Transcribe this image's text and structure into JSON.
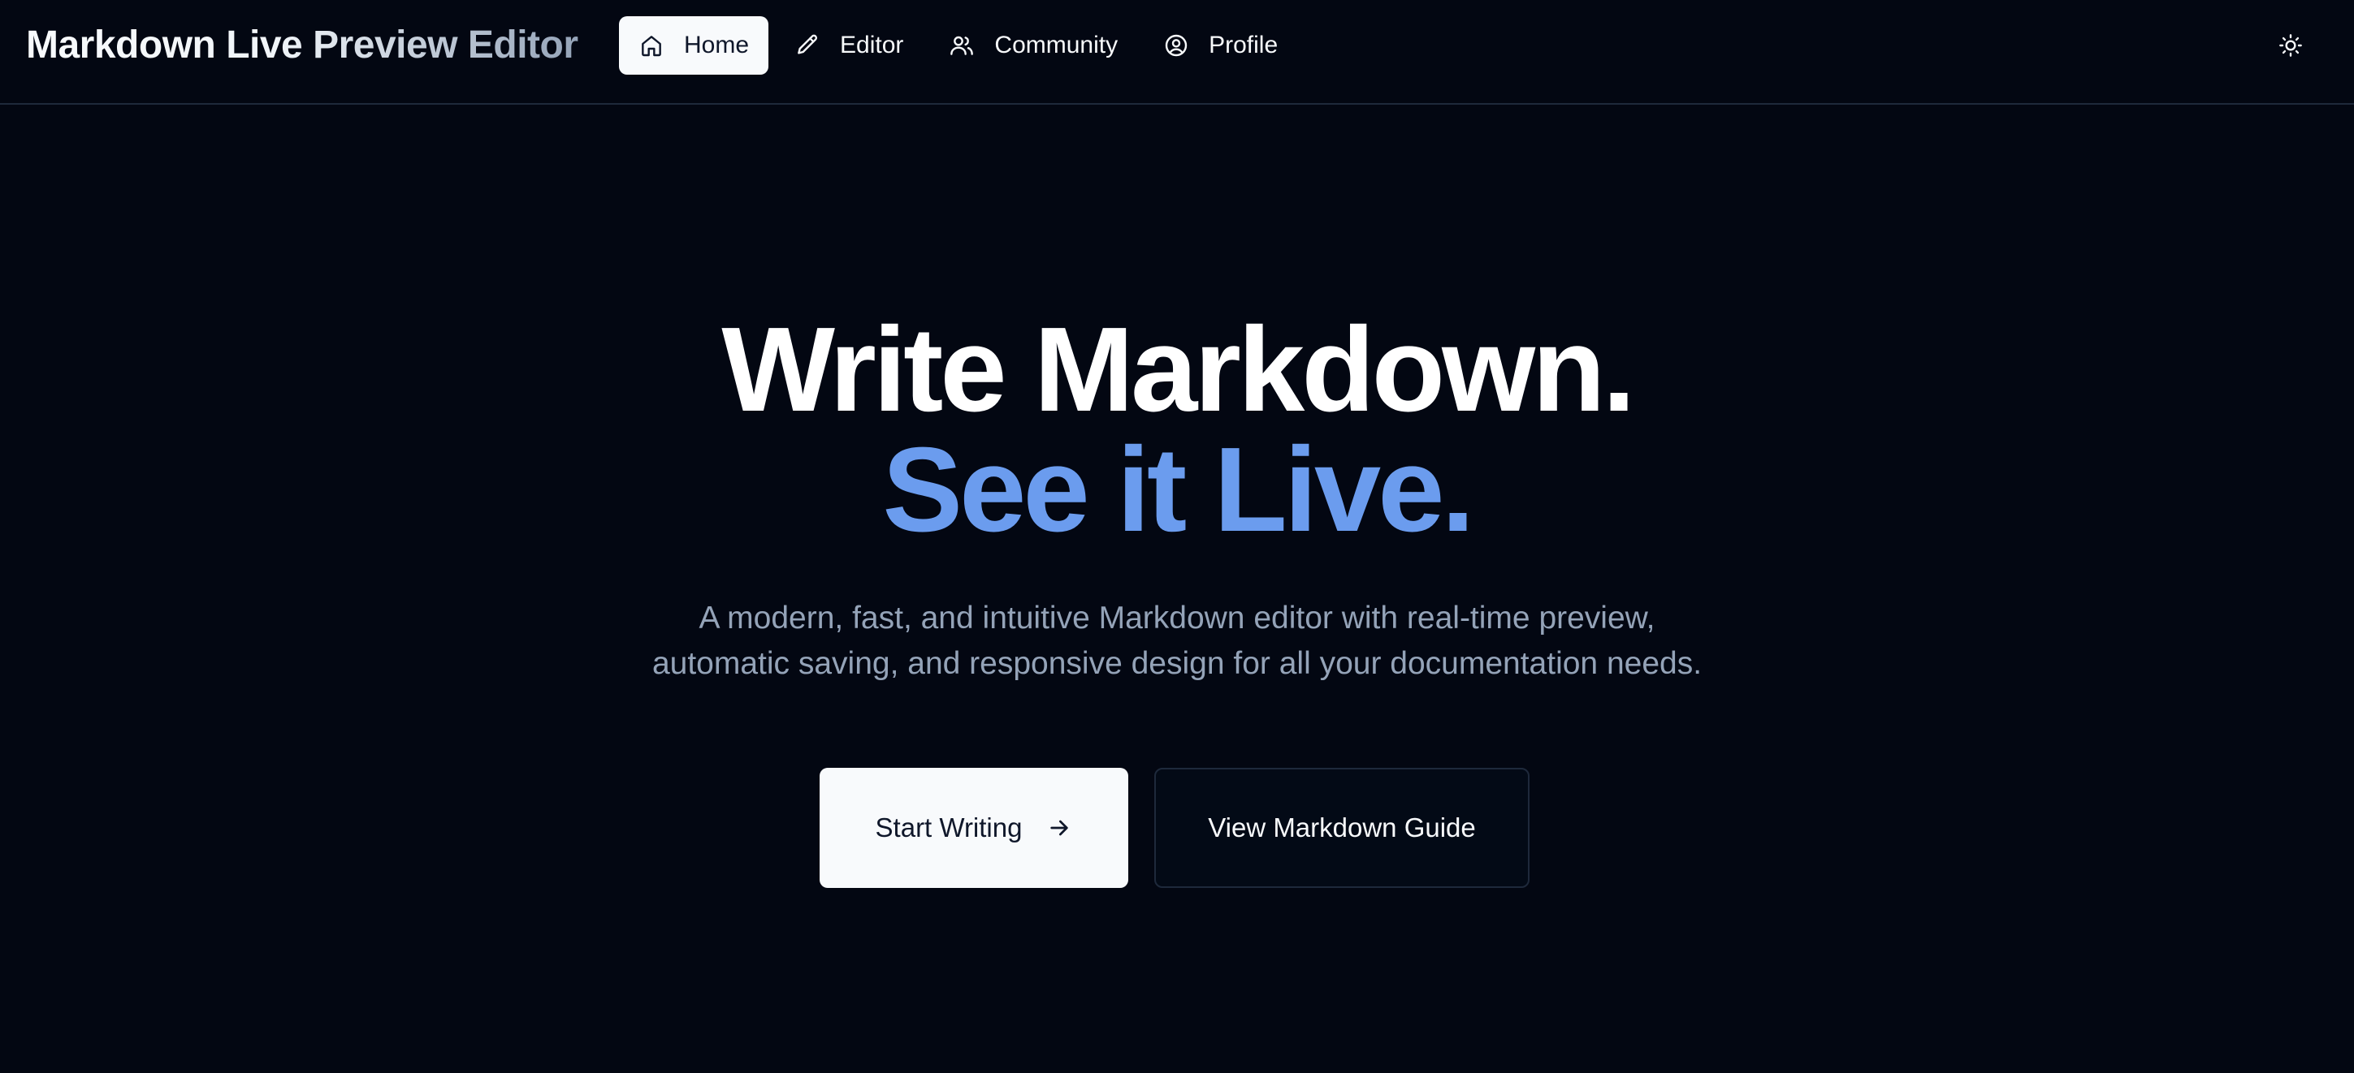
{
  "header": {
    "brand": "Markdown Live Preview Editor",
    "nav": [
      {
        "label": "Home",
        "icon": "home-icon",
        "active": true
      },
      {
        "label": "Editor",
        "icon": "pencil-icon",
        "active": false
      },
      {
        "label": "Community",
        "icon": "users-icon",
        "active": false
      },
      {
        "label": "Profile",
        "icon": "user-circle-icon",
        "active": false
      }
    ],
    "theme_toggle_icon": "sun-icon"
  },
  "hero": {
    "headline_line1": "Write Markdown.",
    "headline_line2": "See it Live.",
    "subtitle_line1": "A modern, fast, and intuitive Markdown editor with real-time preview,",
    "subtitle_line2": "automatic saving, and responsive design for all your documentation needs.",
    "primary_button": {
      "label": "Start Writing",
      "icon": "arrow-right-icon"
    },
    "secondary_button": {
      "label": "View Markdown Guide"
    }
  },
  "colors": {
    "background": "#030712",
    "accent": "#6b9cee",
    "muted_text": "#94a3b8",
    "border": "#1e293b",
    "active_nav_bg": "#f8fafc"
  }
}
